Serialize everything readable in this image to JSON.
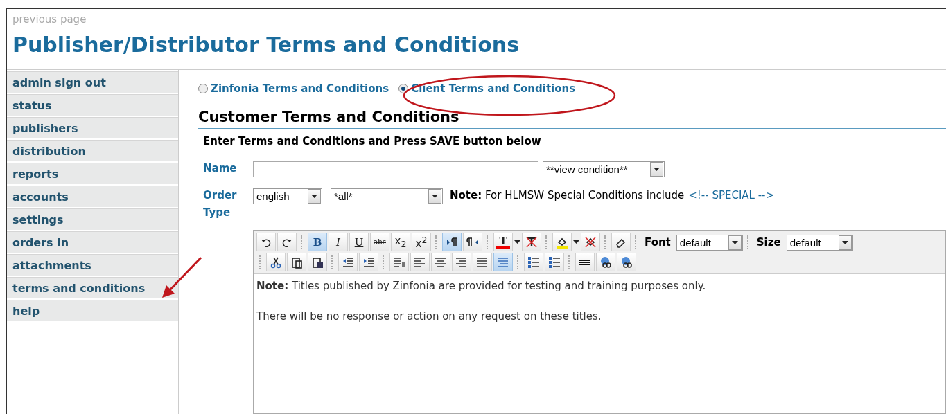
{
  "header": {
    "back_link": "previous page",
    "title": "Publisher/Distributor Terms and Conditions"
  },
  "sidebar": {
    "items": [
      {
        "label": "admin sign out"
      },
      {
        "label": "status"
      },
      {
        "label": "publishers"
      },
      {
        "label": "distribution"
      },
      {
        "label": "reports"
      },
      {
        "label": "accounts"
      },
      {
        "label": "settings"
      },
      {
        "label": "orders in"
      },
      {
        "label": "attachments"
      },
      {
        "label": "terms and conditions"
      },
      {
        "label": "help"
      }
    ]
  },
  "mode_options": [
    {
      "label": "Zinfonia Terms and Conditions",
      "selected": false
    },
    {
      "label": "Client Terms and Conditions",
      "selected": true
    }
  ],
  "section_title": "Customer Terms and Conditions",
  "instructions": "Enter Terms and Conditions and Press SAVE button below",
  "form": {
    "name_label": "Name",
    "condition_select": "**view condition**",
    "order_type_label": "Order Type",
    "language_select": "english",
    "type_select": "*all*",
    "note": "**Note:** For HLMSW Special Conditions include",
    "special_tag": "<!-- SPECIAL -->"
  },
  "editor": {
    "toolbar_rows": [
      [
        {
          "kind": "undo",
          "active": false
        },
        {
          "kind": "redo",
          "active": false
        },
        {
          "kind": "sep"
        },
        {
          "kind": "bold",
          "label": "B",
          "active": true
        },
        {
          "kind": "italic",
          "label": "I",
          "active": false
        },
        {
          "kind": "underline",
          "label": "U",
          "active": false
        },
        {
          "kind": "strike",
          "label": "abc",
          "active": false
        },
        {
          "kind": "sub",
          "label": "x$_{2}$",
          "active": false
        },
        {
          "kind": "sup",
          "label": "x$^{2}$",
          "active": false
        },
        {
          "kind": "sep"
        },
        {
          "kind": "ltr",
          "active": true
        },
        {
          "kind": "rtl",
          "active": false
        },
        {
          "kind": "sep"
        },
        {
          "kind": "textcolor",
          "label": "T",
          "active": false
        },
        {
          "kind": "caret"
        },
        {
          "kind": "nocolor",
          "active": false
        },
        {
          "kind": "sep"
        },
        {
          "kind": "highlight",
          "active": false
        },
        {
          "kind": "caret"
        },
        {
          "kind": "nohighlight",
          "active": false
        },
        {
          "kind": "sep"
        },
        {
          "kind": "eraser",
          "active": false
        },
        {
          "kind": "sep"
        },
        {
          "kind": "select",
          "label": "Font",
          "value": "default"
        },
        {
          "kind": "sep"
        },
        {
          "kind": "select",
          "label": "Size",
          "value": "default"
        }
      ],
      [
        {
          "kind": "sep"
        },
        {
          "kind": "cut",
          "active": false
        },
        {
          "kind": "paste",
          "active": false
        },
        {
          "kind": "pasteword",
          "active": false
        },
        {
          "kind": "sep"
        },
        {
          "kind": "outdent",
          "active": false
        },
        {
          "kind": "indent",
          "active": false
        },
        {
          "kind": "sep"
        },
        {
          "kind": "paragraph",
          "active": false
        },
        {
          "kind": "left",
          "active": false
        },
        {
          "kind": "center",
          "active": false
        },
        {
          "kind": "right",
          "active": false
        },
        {
          "kind": "justify",
          "active": false
        },
        {
          "kind": "wrap",
          "active": true
        },
        {
          "kind": "sep"
        },
        {
          "kind": "ol",
          "active": false
        },
        {
          "kind": "ul",
          "active": false
        },
        {
          "kind": "sep"
        },
        {
          "kind": "hr",
          "active": false
        },
        {
          "kind": "link",
          "active": false
        },
        {
          "kind": "unlink",
          "active": false
        }
      ]
    ],
    "content": [
      "**Note:** Titles published by Zinfonia are provided for testing and training purposes only.",
      "There will be no response or action on any request on these titles."
    ]
  }
}
